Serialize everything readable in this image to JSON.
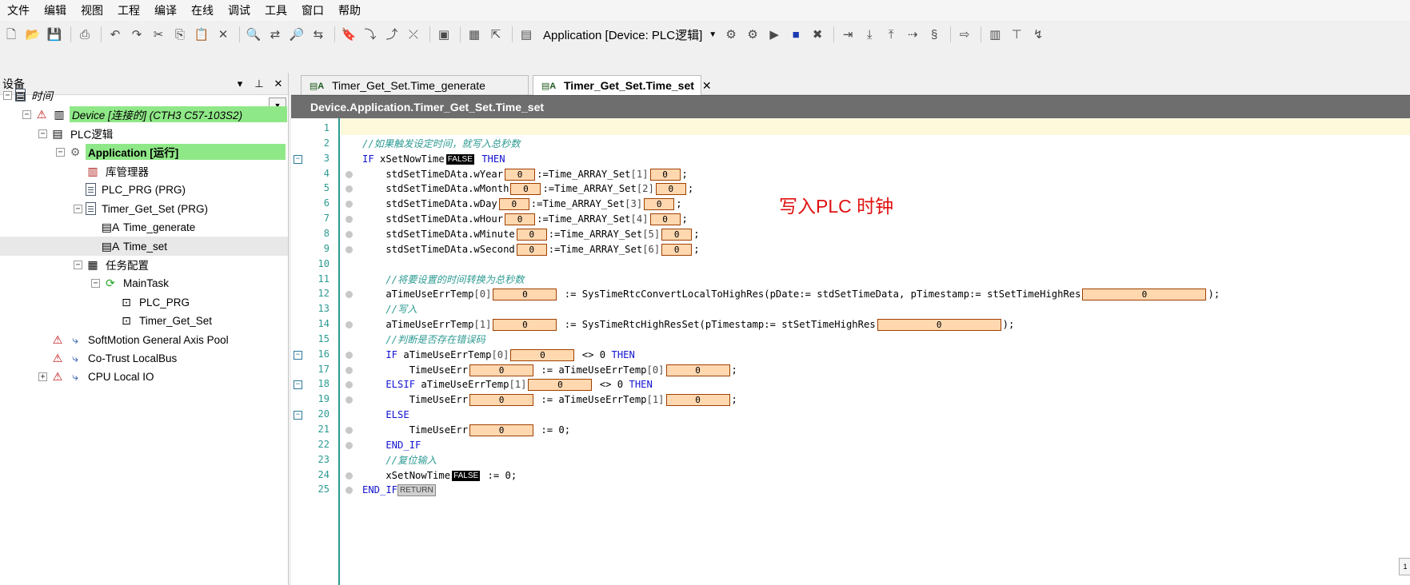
{
  "menu": [
    "文件",
    "编辑",
    "视图",
    "工程",
    "编译",
    "在线",
    "调试",
    "工具",
    "窗口",
    "帮助"
  ],
  "toolbar": {
    "app_combo": "Application [Device: PLC逻辑]"
  },
  "left_pane": {
    "title": "设备",
    "tree": [
      {
        "label": "时间",
        "depth": 0,
        "expander": "-",
        "icon": "project-icon",
        "italic": true
      },
      {
        "label": "Device [连接的] (CTH3 C57-103S2)",
        "depth": 1,
        "expander": "-",
        "icon": "device-icon",
        "warn": true,
        "italic": true,
        "highlight": true
      },
      {
        "label": "PLC逻辑",
        "depth": 2,
        "expander": "-",
        "icon": "plc-logic-icon"
      },
      {
        "label": "Application [运行]",
        "depth": 3,
        "expander": "-",
        "icon": "application-gear-icon",
        "bold": true,
        "highlight": true
      },
      {
        "label": "库管理器",
        "depth": 4,
        "icon": "library-icon"
      },
      {
        "label": "PLC_PRG (PRG)",
        "depth": 4,
        "icon": "program-icon"
      },
      {
        "label": "Timer_Get_Set (PRG)",
        "depth": 4,
        "expander": "-",
        "icon": "program-icon"
      },
      {
        "label": "Time_generate",
        "depth": 5,
        "icon": "action-icon"
      },
      {
        "label": "Time_set",
        "depth": 5,
        "icon": "action-icon",
        "selected": true
      },
      {
        "label": "任务配置",
        "depth": 4,
        "expander": "-",
        "icon": "task-config-icon"
      },
      {
        "label": "MainTask",
        "depth": 5,
        "expander": "-",
        "icon": "task-icon"
      },
      {
        "label": "PLC_PRG",
        "depth": 6,
        "icon": "call-icon"
      },
      {
        "label": "Timer_Get_Set",
        "depth": 6,
        "icon": "call-icon"
      },
      {
        "label": "SoftMotion General Axis Pool",
        "depth": 2,
        "icon": "io-icon",
        "warn": true
      },
      {
        "label": "Co-Trust LocalBus",
        "depth": 2,
        "icon": "io-icon",
        "warn": true
      },
      {
        "label": "CPU Local IO",
        "depth": 2,
        "expander": "+",
        "icon": "io-icon",
        "warn": true
      }
    ]
  },
  "editor": {
    "tabs": [
      {
        "label": "Timer_Get_Set.Time_generate",
        "active": false
      },
      {
        "label": "Timer_Get_Set.Time_set",
        "active": true
      }
    ],
    "path": "Device.Application.Timer_Get_Set.Time_set",
    "annotation": "写入PLC 时钟",
    "lines": [
      {
        "n": "1",
        "parts": []
      },
      {
        "n": "2",
        "parts": [
          {
            "c": "cm",
            "t": "//如果触发设定时间，就写入总秒数"
          }
        ]
      },
      {
        "n": "3",
        "fold": true,
        "parts": [
          {
            "c": "kw",
            "t": "IF "
          },
          {
            "c": "tx",
            "t": "xSetNowTime"
          },
          {
            "bf": "FALSE"
          },
          {
            "c": "kw",
            "t": " THEN"
          }
        ]
      },
      {
        "n": "4",
        "dot": true,
        "parts": [
          {
            "c": "tx",
            "t": "    stdSetTimeDAta.wYear"
          },
          {
            "bx": "0",
            "w": 38
          },
          {
            "c": "tx",
            "t": ":=Time_ARRAY_Set"
          },
          {
            "c": "nm",
            "t": "[1]"
          },
          {
            "bx": "0",
            "w": 38
          },
          {
            "c": "tx",
            "t": ";"
          }
        ]
      },
      {
        "n": "5",
        "dot": true,
        "parts": [
          {
            "c": "tx",
            "t": "    stdSetTimeDAta.wMonth"
          },
          {
            "bx": "0",
            "w": 38
          },
          {
            "c": "tx",
            "t": ":=Time_ARRAY_Set"
          },
          {
            "c": "nm",
            "t": "[2]"
          },
          {
            "bx": "0",
            "w": 38
          },
          {
            "c": "tx",
            "t": ";"
          }
        ]
      },
      {
        "n": "6",
        "dot": true,
        "parts": [
          {
            "c": "tx",
            "t": "    stdSetTimeDAta.wDay"
          },
          {
            "bx": "0",
            "w": 38
          },
          {
            "c": "tx",
            "t": ":=Time_ARRAY_Set"
          },
          {
            "c": "nm",
            "t": "[3]"
          },
          {
            "bx": "0",
            "w": 38
          },
          {
            "c": "tx",
            "t": ";"
          }
        ]
      },
      {
        "n": "7",
        "dot": true,
        "parts": [
          {
            "c": "tx",
            "t": "    stdSetTimeDAta.wHour"
          },
          {
            "bx": "0",
            "w": 38
          },
          {
            "c": "tx",
            "t": ":=Time_ARRAY_Set"
          },
          {
            "c": "nm",
            "t": "[4]"
          },
          {
            "bx": "0",
            "w": 38
          },
          {
            "c": "tx",
            "t": ";"
          }
        ]
      },
      {
        "n": "8",
        "dot": true,
        "parts": [
          {
            "c": "tx",
            "t": "    stdSetTimeDAta.wMinute"
          },
          {
            "bx": "0",
            "w": 38
          },
          {
            "c": "tx",
            "t": ":=Time_ARRAY_Set"
          },
          {
            "c": "nm",
            "t": "[5]"
          },
          {
            "bx": "0",
            "w": 38
          },
          {
            "c": "tx",
            "t": ";"
          }
        ]
      },
      {
        "n": "9",
        "dot": true,
        "parts": [
          {
            "c": "tx",
            "t": "    stdSetTimeDAta.wSecond"
          },
          {
            "bx": "0",
            "w": 38
          },
          {
            "c": "tx",
            "t": ":=Time_ARRAY_Set"
          },
          {
            "c": "nm",
            "t": "[6]"
          },
          {
            "bx": "0",
            "w": 38
          },
          {
            "c": "tx",
            "t": ";"
          }
        ]
      },
      {
        "n": "10",
        "parts": []
      },
      {
        "n": "11",
        "parts": [
          {
            "c": "cm",
            "t": "    //将要设置的时间转换为总秒数"
          }
        ]
      },
      {
        "n": "12",
        "dot": true,
        "parts": [
          {
            "c": "tx",
            "t": "    aTimeUseErrTemp"
          },
          {
            "c": "nm",
            "t": "[0]"
          },
          {
            "bx": "0",
            "w": 80
          },
          {
            "c": "tx",
            "t": " := SysTimeRtcConvertLocalToHighRes(pDate:= stdSetTimeData, pTimestamp:= stSetTimeHighRes"
          },
          {
            "bx": "0",
            "w": 155
          },
          {
            "c": "tx",
            "t": ");"
          }
        ]
      },
      {
        "n": "13",
        "parts": [
          {
            "c": "cm",
            "t": "    //写入"
          }
        ]
      },
      {
        "n": "14",
        "dot": true,
        "parts": [
          {
            "c": "tx",
            "t": "    aTimeUseErrTemp"
          },
          {
            "c": "nm",
            "t": "[1]"
          },
          {
            "bx": "0",
            "w": 80
          },
          {
            "c": "tx",
            "t": " := SysTimeRtcHighResSet(pTimestamp:= stSetTimeHighRes"
          },
          {
            "bx": "0",
            "w": 155
          },
          {
            "c": "tx",
            "t": ");"
          }
        ]
      },
      {
        "n": "15",
        "parts": [
          {
            "c": "cm",
            "t": "    //判断是否存在错误码"
          }
        ]
      },
      {
        "n": "16",
        "fold": true,
        "dot": true,
        "parts": [
          {
            "c": "kw",
            "t": "    IF "
          },
          {
            "c": "tx",
            "t": "aTimeUseErrTemp"
          },
          {
            "c": "nm",
            "t": "[0]"
          },
          {
            "bx": "0",
            "w": 80
          },
          {
            "c": "tx",
            "t": " <> 0 "
          },
          {
            "c": "kw",
            "t": "THEN"
          }
        ]
      },
      {
        "n": "17",
        "dot": true,
        "parts": [
          {
            "c": "tx",
            "t": "        TimeUseErr"
          },
          {
            "bx": "0",
            "w": 80
          },
          {
            "c": "tx",
            "t": " := aTimeUseErrTemp"
          },
          {
            "c": "nm",
            "t": "[0]"
          },
          {
            "bx": "0",
            "w": 80
          },
          {
            "c": "tx",
            "t": ";"
          }
        ]
      },
      {
        "n": "18",
        "fold": true,
        "dot": true,
        "parts": [
          {
            "c": "kw",
            "t": "    ELSIF "
          },
          {
            "c": "tx",
            "t": "aTimeUseErrTemp"
          },
          {
            "c": "nm",
            "t": "[1]"
          },
          {
            "bx": "0",
            "w": 80
          },
          {
            "c": "tx",
            "t": " <> 0 "
          },
          {
            "c": "kw",
            "t": "THEN"
          }
        ]
      },
      {
        "n": "19",
        "dot": true,
        "parts": [
          {
            "c": "tx",
            "t": "        TimeUseErr"
          },
          {
            "bx": "0",
            "w": 80
          },
          {
            "c": "tx",
            "t": " := aTimeUseErrTemp"
          },
          {
            "c": "nm",
            "t": "[1]"
          },
          {
            "bx": "0",
            "w": 80
          },
          {
            "c": "tx",
            "t": ";"
          }
        ]
      },
      {
        "n": "20",
        "fold": true,
        "parts": [
          {
            "c": "kw",
            "t": "    ELSE"
          }
        ]
      },
      {
        "n": "21",
        "dot": true,
        "parts": [
          {
            "c": "tx",
            "t": "        TimeUseErr"
          },
          {
            "bx": "0",
            "w": 80
          },
          {
            "c": "tx",
            "t": " := 0;"
          }
        ]
      },
      {
        "n": "22",
        "dot": true,
        "parts": [
          {
            "c": "kw",
            "t": "    END_IF"
          }
        ]
      },
      {
        "n": "23",
        "parts": [
          {
            "c": "cm",
            "t": "    //复位输入"
          }
        ]
      },
      {
        "n": "24",
        "dot": true,
        "parts": [
          {
            "c": "tx",
            "t": "    xSetNowTime"
          },
          {
            "bf": "FALSE"
          },
          {
            "c": "tx",
            "t": " := 0;"
          }
        ]
      },
      {
        "n": "25",
        "dot": true,
        "parts": [
          {
            "c": "kw",
            "t": "END_IF"
          },
          {
            "br": "RETURN"
          }
        ]
      }
    ]
  }
}
